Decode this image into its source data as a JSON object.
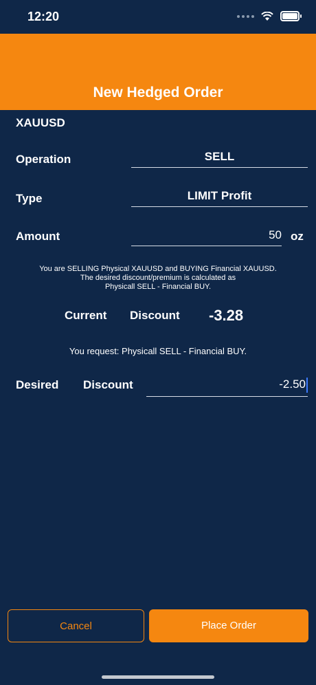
{
  "status_bar": {
    "time": "12:20"
  },
  "header": {
    "title": "New Hedged Order"
  },
  "symbol": "XAUUSD",
  "form": {
    "operation_label": "Operation",
    "operation_value": "SELL",
    "type_label": "Type",
    "type_value": "LIMIT Profit",
    "amount_label": "Amount",
    "amount_value": "50",
    "amount_unit": "oz"
  },
  "info": {
    "line1": "You are SELLING Physical XAUUSD and BUYING Financial XAUUSD.",
    "line2": "The desired discount/premium is calculated as",
    "line3": "Physicall SELL - Financial BUY."
  },
  "current": {
    "label1": "Current",
    "label2": "Discount",
    "value": "-3.28"
  },
  "request_text": "You request: Physicall SELL - Financial BUY.",
  "desired": {
    "label1": "Desired",
    "label2": "Discount",
    "value": "-2.50"
  },
  "buttons": {
    "cancel": "Cancel",
    "place": "Place Order"
  },
  "colors": {
    "background": "#0f2748",
    "accent": "#f58710"
  }
}
